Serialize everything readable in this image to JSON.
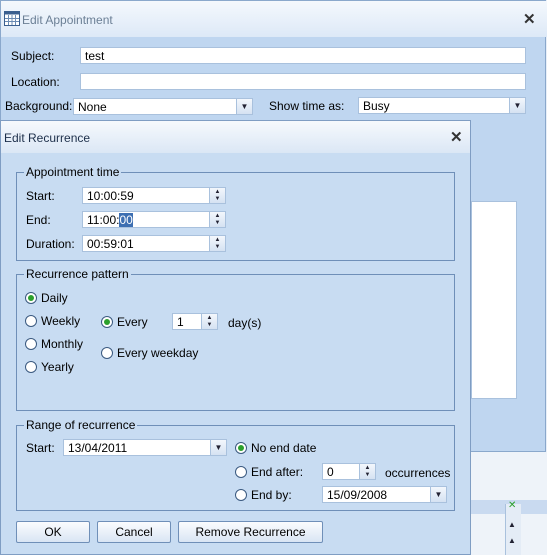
{
  "appointment": {
    "title": "Edit Appointment",
    "subject_label": "Subject:",
    "subject_value": "test",
    "location_label": "Location:",
    "location_value": "",
    "background_label": "Background:",
    "background_value": "None",
    "show_time_label": "Show time as:",
    "show_time_value": "Busy"
  },
  "recurrence": {
    "title": "Edit Recurrence",
    "appointment_time": {
      "legend": "Appointment time",
      "start_label": "Start:",
      "start_value": "10:00:59",
      "end_label": "End:",
      "end_value_prefix": "11:00:",
      "end_value_selected": "00",
      "duration_label": "Duration:",
      "duration_value": "00:59:01"
    },
    "pattern": {
      "legend": "Recurrence pattern",
      "options": [
        "Daily",
        "Weekly",
        "Monthly",
        "Yearly"
      ],
      "selected": "Daily",
      "every_label": "Every",
      "every_value": "1",
      "every_unit": "day(s)",
      "every_weekday_label": "Every weekday"
    },
    "range": {
      "legend": "Range of recurrence",
      "start_label": "Start:",
      "start_value": "13/04/2011",
      "no_end_label": "No end date",
      "end_after_label": "End after:",
      "end_after_value": "0",
      "occurrences_label": "occurrences",
      "end_by_label": "End by:",
      "end_by_value": "15/09/2008"
    },
    "buttons": {
      "ok": "OK",
      "cancel": "Cancel",
      "remove": "Remove Recurrence"
    }
  },
  "colors": {
    "dialog_bg": "#c8dcf2",
    "radio_on": "#2ca02c",
    "selection": "#3d6fb2"
  }
}
